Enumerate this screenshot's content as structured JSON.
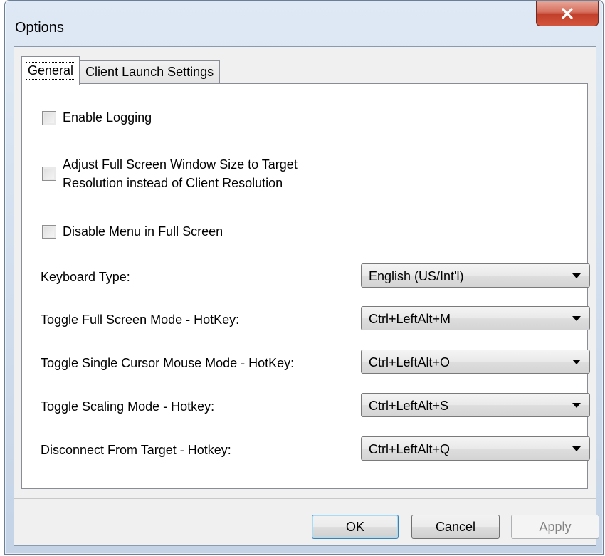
{
  "window": {
    "title": "Options",
    "close_glyph": "close-icon"
  },
  "tabs": [
    {
      "label": "General",
      "active": true
    },
    {
      "label": "Client Launch Settings",
      "active": false
    }
  ],
  "general": {
    "checkboxes": [
      {
        "label": "Enable Logging",
        "checked": false
      },
      {
        "label_line1": "Adjust Full Screen Window Size to Target",
        "label_line2": "Resolution instead of Client Resolution",
        "checked": false
      },
      {
        "label": "Disable Menu in Full Screen",
        "checked": false
      }
    ],
    "settings": [
      {
        "label": "Keyboard Type:",
        "value": "English (US/Int'l)"
      },
      {
        "label": "Toggle Full Screen Mode - HotKey:",
        "value": "Ctrl+LeftAlt+M"
      },
      {
        "label": "Toggle Single Cursor Mouse Mode - HotKey:",
        "value": "Ctrl+LeftAlt+O"
      },
      {
        "label": "Toggle Scaling Mode - Hotkey:",
        "value": "Ctrl+LeftAlt+S"
      },
      {
        "label": "Disconnect From Target - Hotkey:",
        "value": "Ctrl+LeftAlt+Q"
      }
    ]
  },
  "buttons": {
    "ok": "OK",
    "cancel": "Cancel",
    "apply": "Apply"
  },
  "colors": {
    "close_button": "#c2402b",
    "default_button_border": "#3c7fb1",
    "disabled_text": "#838383"
  }
}
